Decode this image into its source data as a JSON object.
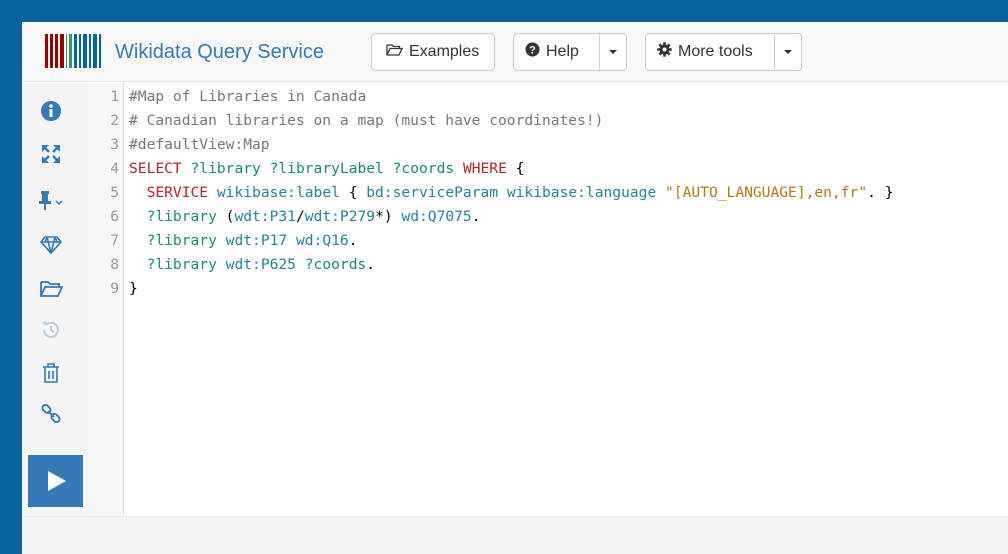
{
  "brand": {
    "title": "Wikidata Query Service"
  },
  "toolbar": {
    "examples_label": "Examples",
    "help_label": "Help",
    "more_tools_label": "More tools"
  },
  "sidebar": {
    "icons": [
      "info-icon",
      "fullscreen-icon",
      "pin-icon",
      "gem-icon",
      "folder-open-icon",
      "history-icon",
      "trash-icon",
      "link-icon"
    ],
    "run_icon": "play-icon"
  },
  "editor": {
    "line_numbers": [
      "1",
      "2",
      "3",
      "4",
      "5",
      "6",
      "7",
      "8",
      "9"
    ],
    "lines": [
      [
        {
          "t": "#Map of Libraries in Canada",
          "c": "c-comment"
        }
      ],
      [
        {
          "t": "# Canadian libraries on a map (must have coordinates!)",
          "c": "c-comment"
        }
      ],
      [
        {
          "t": "#defaultView:Map",
          "c": "c-comment"
        }
      ],
      [
        {
          "t": "SELECT",
          "c": "c-kw"
        },
        {
          "t": " "
        },
        {
          "t": "?library",
          "c": "c-var"
        },
        {
          "t": " "
        },
        {
          "t": "?libraryLabel",
          "c": "c-var"
        },
        {
          "t": " "
        },
        {
          "t": "?coords",
          "c": "c-var"
        },
        {
          "t": " "
        },
        {
          "t": "WHERE",
          "c": "c-kw"
        },
        {
          "t": " {"
        }
      ],
      [
        {
          "t": "  "
        },
        {
          "t": "SERVICE",
          "c": "c-kw"
        },
        {
          "t": " "
        },
        {
          "t": "wikibase:label",
          "c": "c-pref"
        },
        {
          "t": " { "
        },
        {
          "t": "bd:serviceParam",
          "c": "c-pref"
        },
        {
          "t": " "
        },
        {
          "t": "wikibase:language",
          "c": "c-pref"
        },
        {
          "t": " "
        },
        {
          "t": "\"[AUTO_LANGUAGE],en,fr\"",
          "c": "c-str"
        },
        {
          "t": ". }"
        }
      ],
      [
        {
          "t": "  "
        },
        {
          "t": "?library",
          "c": "c-var"
        },
        {
          "t": " ("
        },
        {
          "t": "wdt:P31",
          "c": "c-pref"
        },
        {
          "t": "/"
        },
        {
          "t": "wdt:P279",
          "c": "c-pref"
        },
        {
          "t": "*) "
        },
        {
          "t": "wd:Q7075",
          "c": "c-pref"
        },
        {
          "t": "."
        }
      ],
      [
        {
          "t": "  "
        },
        {
          "t": "?library",
          "c": "c-var"
        },
        {
          "t": " "
        },
        {
          "t": "wdt:P17",
          "c": "c-pref"
        },
        {
          "t": " "
        },
        {
          "t": "wd:Q16",
          "c": "c-pref"
        },
        {
          "t": "."
        }
      ],
      [
        {
          "t": "  "
        },
        {
          "t": "?library",
          "c": "c-var"
        },
        {
          "t": " "
        },
        {
          "t": "wdt:P625",
          "c": "c-pref"
        },
        {
          "t": " "
        },
        {
          "t": "?coords",
          "c": "c-var"
        },
        {
          "t": "."
        }
      ],
      [
        {
          "t": "}"
        }
      ]
    ]
  },
  "colors": {
    "outer_bg": "#08639c",
    "link_blue": "#337ab7",
    "logo_red": "#990000",
    "logo_green": "#339966",
    "logo_blue": "#006699"
  }
}
